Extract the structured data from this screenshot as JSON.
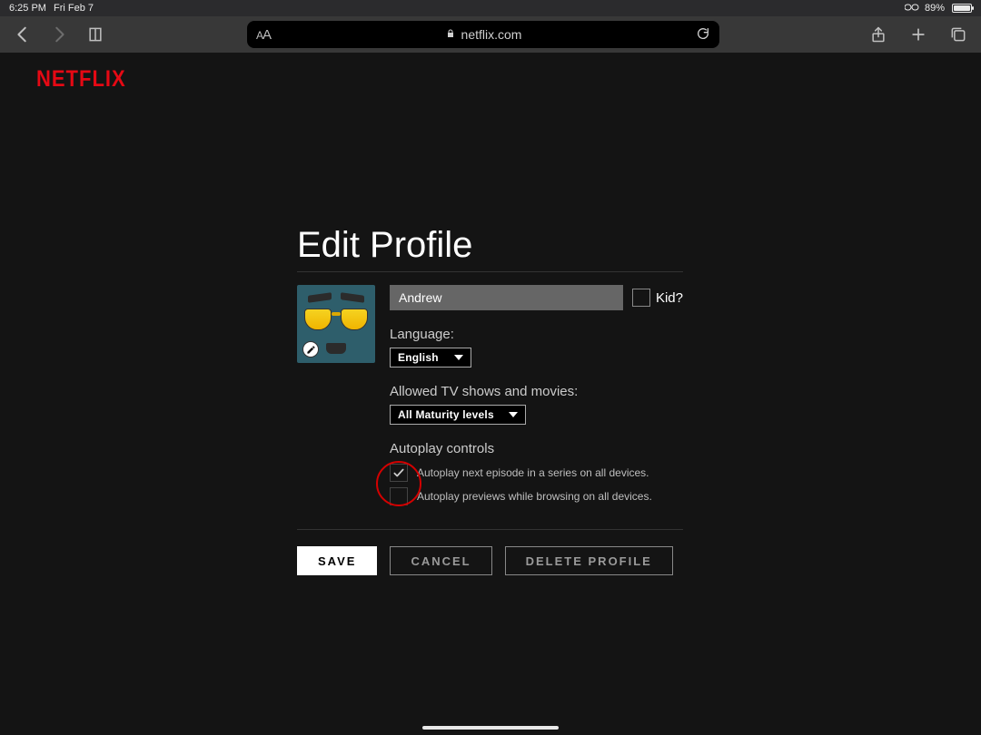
{
  "status": {
    "time": "6:25 PM",
    "date": "Fri Feb 7",
    "battery_pct": "89%"
  },
  "browser": {
    "url_host": "netflix.com",
    "aa_small": "A",
    "aa_big": "A"
  },
  "logo_text": "NETFLIX",
  "title": "Edit Profile",
  "profile": {
    "name": "Andrew",
    "kid_label": "Kid?",
    "kid_checked": false
  },
  "language": {
    "label": "Language:",
    "value": "English"
  },
  "maturity": {
    "label": "Allowed TV shows and movies:",
    "value": "All Maturity levels"
  },
  "autoplay": {
    "label": "Autoplay controls",
    "next_episode": {
      "text": "Autoplay next episode in a series on all devices.",
      "checked": true
    },
    "previews": {
      "text": "Autoplay previews while browsing on all devices.",
      "checked": false
    }
  },
  "buttons": {
    "save": "SAVE",
    "cancel": "CANCEL",
    "delete": "DELETE PROFILE"
  }
}
